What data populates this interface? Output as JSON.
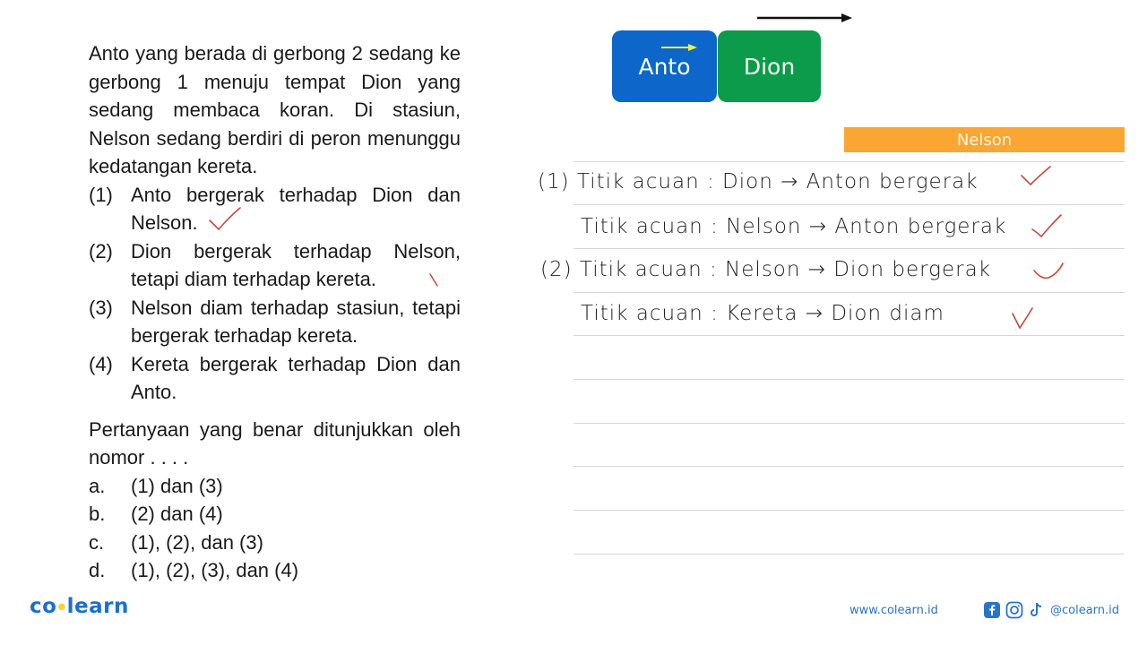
{
  "question": {
    "intro": "Anto yang berada di gerbong 2 sedang ke gerbong 1 menuju tempat Dion yang sedang membaca koran. Di stasiun, Nelson sedang berdiri di peron menunggu kedatangan kereta.",
    "statements": [
      {
        "num": "(1)",
        "text": "Anto bergerak terhadap Dion dan Nelson."
      },
      {
        "num": "(2)",
        "text": "Dion bergerak terhadap Nelson, tetapi diam terhadap kereta."
      },
      {
        "num": "(3)",
        "text": "Nelson diam terhadap stasiun, tetapi bergerak terhadap kereta."
      },
      {
        "num": "(4)",
        "text": "Kereta bergerak terhadap Dion dan Anto."
      }
    ],
    "prompt": "Pertanyaan yang benar ditunjukkan oleh nomor . . . .",
    "options": [
      {
        "letter": "a.",
        "text": "(1) dan (3)"
      },
      {
        "letter": "b.",
        "text": "(2) dan (4)"
      },
      {
        "letter": "c.",
        "text": "(1), (2), dan (3)"
      },
      {
        "letter": "d.",
        "text": "(1), (2), (3), dan (4)"
      }
    ]
  },
  "diagram": {
    "car_anto": "Anto",
    "car_dion": "Dion",
    "platform_label": "Nelson",
    "colors": {
      "anto": "#0d66c9",
      "dion": "#0c9b4b",
      "nelson": "#fba532",
      "anto_arrow": "#e6f04a",
      "check": "#c9463c"
    }
  },
  "handwriting": [
    {
      "text": "(1) Titik acuan : Dion → Anton bergerak",
      "checked": true
    },
    {
      "text": "Titik acuan : Nelson → Anton bergerak",
      "checked": true
    },
    {
      "text": "(2) Titik acuan : Nelson → Dion bergerak",
      "checked": true
    },
    {
      "text": "Titik acuan : Kereta → Dion diam",
      "checked": true
    }
  ],
  "footer": {
    "logo_left": "co",
    "logo_right": "learn",
    "website": "www.colearn.id",
    "social_handle": "@colearn.id",
    "social_icons": [
      "facebook-icon",
      "instagram-icon",
      "tiktok-icon"
    ]
  }
}
